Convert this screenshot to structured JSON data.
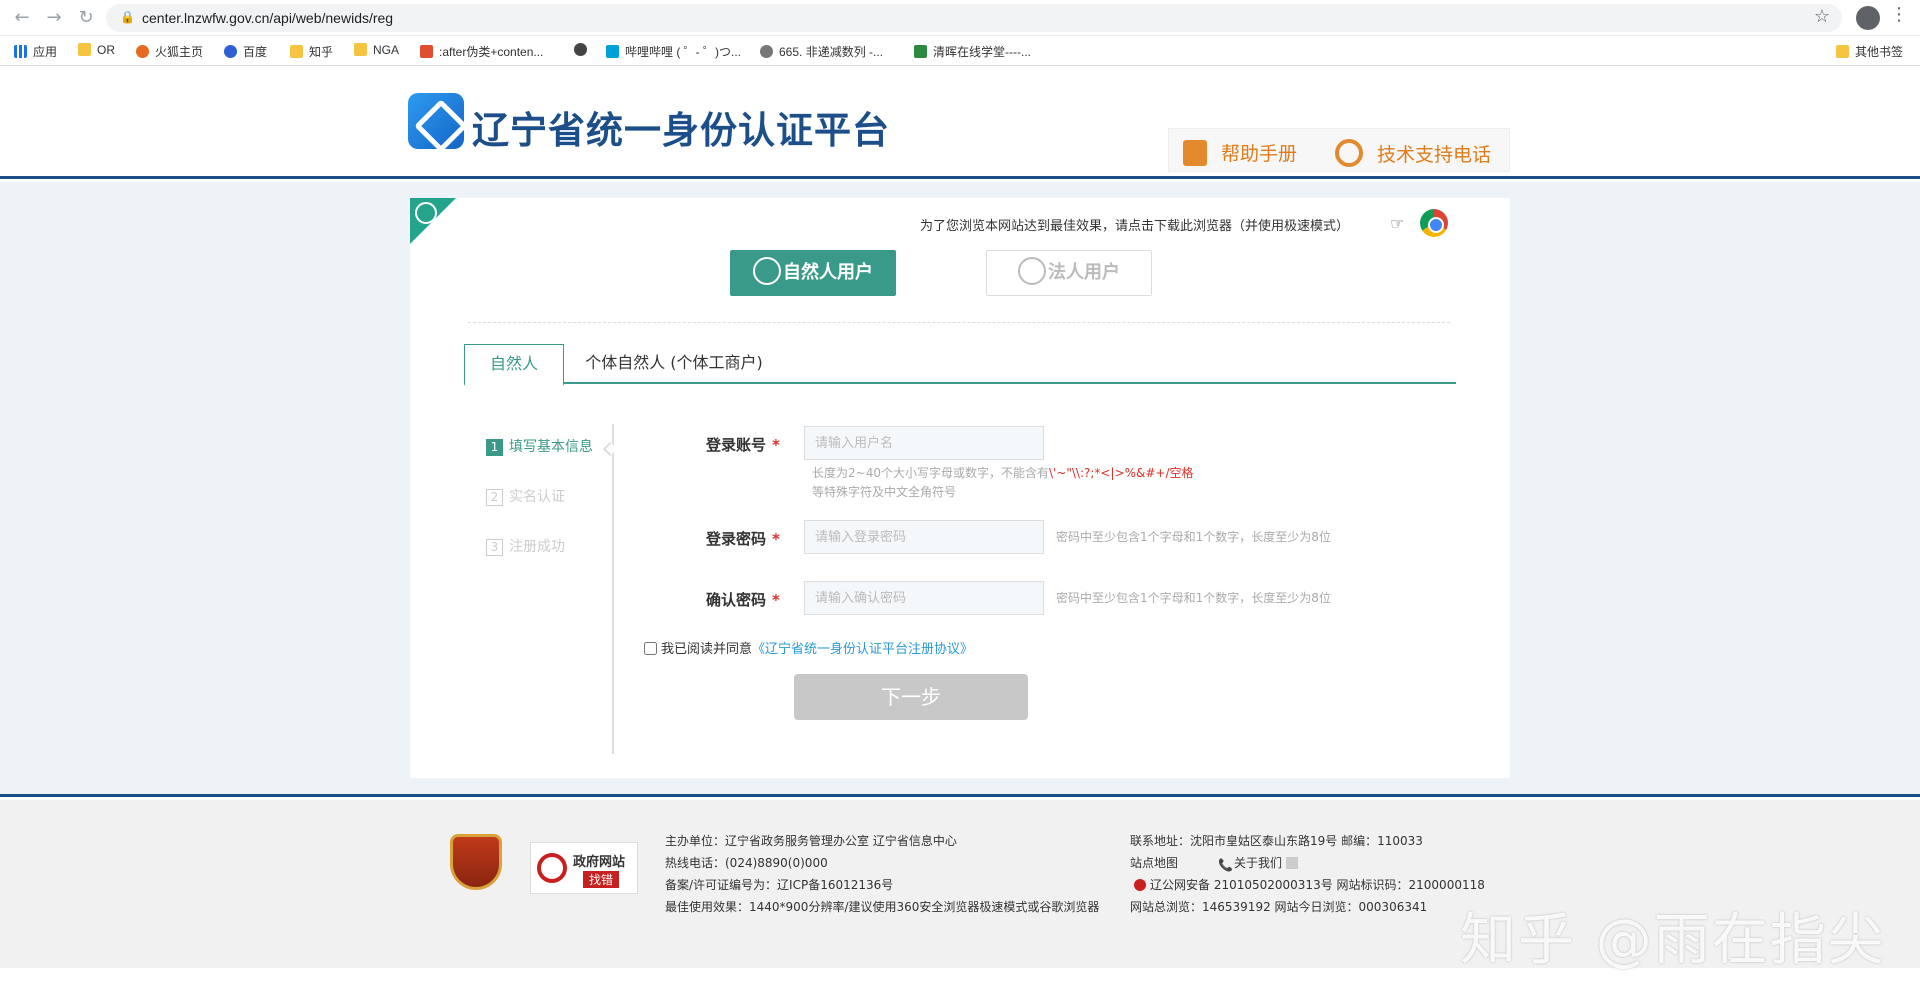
{
  "browser": {
    "url": "center.lnzwfw.gov.cn/api/web/newids/reg",
    "bookmarks": [
      {
        "label": "应用",
        "icon": "apps-icon"
      },
      {
        "label": "OR",
        "icon": "folder-icon"
      },
      {
        "label": "火狐主页",
        "icon": "firefox-icon"
      },
      {
        "label": "百度",
        "icon": "baidu-icon"
      },
      {
        "label": "知乎",
        "icon": "folder-icon"
      },
      {
        "label": "NGA",
        "icon": "folder-icon"
      },
      {
        "label": ":after伪类+conten...",
        "icon": "csdn-icon"
      },
      {
        "label": "",
        "icon": "github-icon"
      },
      {
        "label": "哔哩哔哩 ( ゜- ゜)つ...",
        "icon": "bilibili-icon"
      },
      {
        "label": "665. 非递减数列 -...",
        "icon": "leetcode-icon"
      },
      {
        "label": "清晖在线学堂----...",
        "icon": "edu-icon"
      }
    ],
    "other_bookmarks": "其他书签"
  },
  "header": {
    "title": "辽宁省统一身份认证平台",
    "help_label": "帮助手册",
    "support_label": "技术支持电话"
  },
  "card": {
    "browser_tip": "为了您浏览本网站达到最佳效果，请点击下载此浏览器（并使用极速模式）",
    "user_types": {
      "natural": "自然人用户",
      "legal": "法人用户"
    },
    "tabs": {
      "active": "自然人",
      "other": "个体自然人 (个体工商户)"
    },
    "steps": [
      {
        "num": "1",
        "label": "填写基本信息"
      },
      {
        "num": "2",
        "label": "实名认证"
      },
      {
        "num": "3",
        "label": "注册成功"
      }
    ],
    "form": {
      "account_label": "登录账号",
      "account_placeholder": "请输入用户名",
      "account_hint_1": "长度为2~40个大小写字母或数字，不能含有",
      "account_hint_red": "\\'~\"\\\\:?;*<|>%&#+/空格",
      "account_hint_2": "等特殊字符及中文全角符号",
      "password_label": "登录密码",
      "password_placeholder": "请输入登录密码",
      "password_hint": "密码中至少包含1个字母和1个数字，长度至少为8位",
      "confirm_label": "确认密码",
      "confirm_placeholder": "请输入确认密码",
      "confirm_hint": "密码中至少包含1个字母和1个数字，长度至少为8位",
      "required_mark": "*",
      "agree_text": "我已阅读并同意",
      "agree_link": "《辽宁省统一身份认证平台注册协议》",
      "next_label": "下一步"
    }
  },
  "footer": {
    "badge_line1": "政府网站",
    "badge_line2": "找错",
    "col1": [
      "主办单位：辽宁省政务服务管理办公室    辽宁省信息中心",
      "热线电话：(024)8890(0)000",
      "备案/许可证编号为：辽ICP备16012136号",
      "最佳使用效果：1440*900分辨率/建议使用360安全浏览器极速模式或谷歌浏览器"
    ],
    "address": "联系地址：沈阳市皇姑区泰山东路19号    邮编：110033",
    "sitemap": "站点地图",
    "about": "关于我们",
    "security": "辽公网安备 21010502000313号 网站标识码：2100000118",
    "stats": "网站总浏览：146539192    网站今日浏览：000306341"
  },
  "watermark": "知乎 @雨在指尖",
  "colors": {
    "brand": "#1c4e8a",
    "accent": "#3a9a8a",
    "orange": "#e07b1a",
    "required": "#e02e2e"
  }
}
